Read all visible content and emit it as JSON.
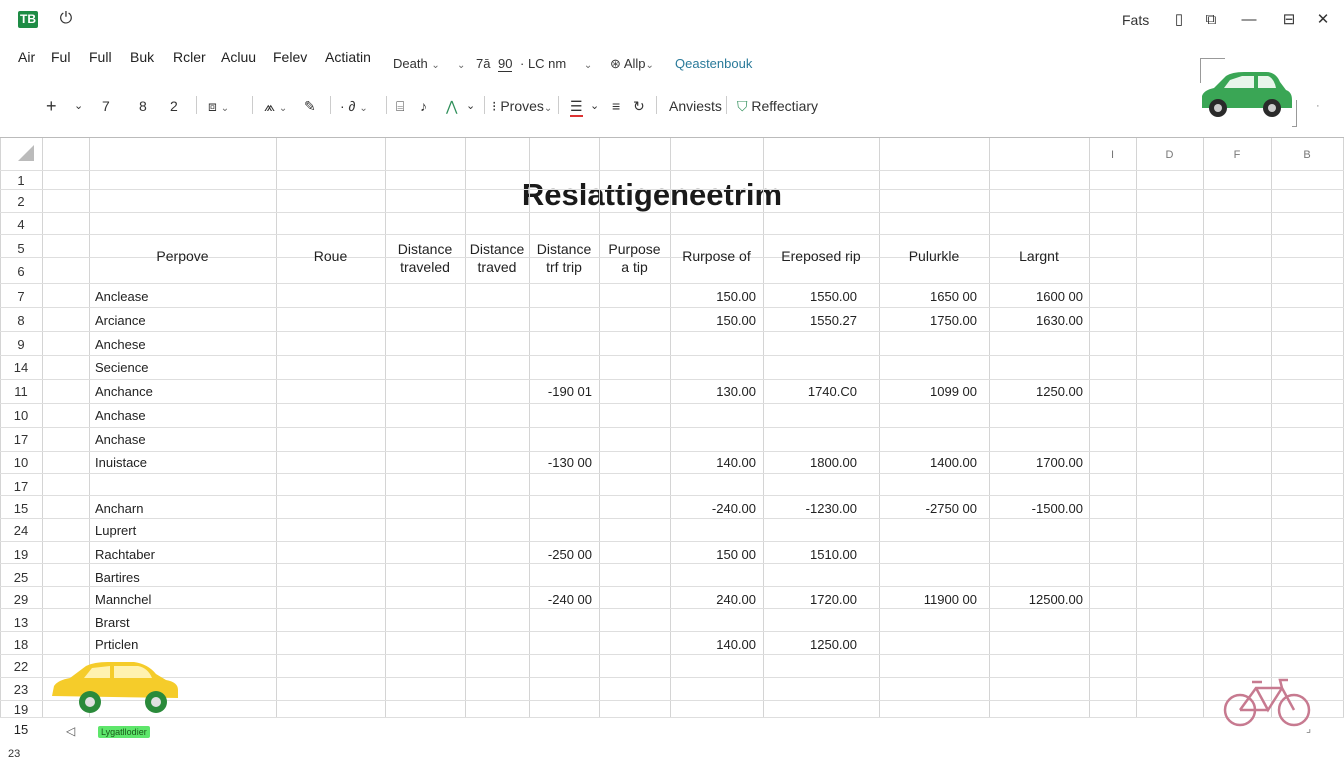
{
  "titlebar": {
    "app_logo": "TB",
    "window_title": "Fats",
    "icons": [
      "power-icon",
      "phone-icon",
      "share-icon",
      "minimize-icon",
      "restore-icon",
      "close-icon"
    ]
  },
  "menu": {
    "items": [
      "Air",
      "Ful",
      "Full",
      "Buk",
      "Rcler",
      "Acluu",
      "Felev",
      "Actiatin"
    ],
    "death": "Death",
    "seven_a": "7ā",
    "ninety": "90",
    "lc_nm": "LC nm",
    "allp": "Allp",
    "search_label": "Qeastenbouk"
  },
  "toolbar": {
    "plus": "+",
    "seven": "7",
    "eight": "8",
    "two": "2",
    "proves": "Proves",
    "anviests": "Anviests",
    "reflectiary": "Reffectiary"
  },
  "sheet": {
    "title": "Reslattigeneetrim",
    "column_letters": [
      "I",
      "D",
      "F",
      "B"
    ],
    "headers": [
      {
        "l1": "Perpove",
        "l2": ""
      },
      {
        "l1": "Roue",
        "l2": ""
      },
      {
        "l1": "Distance",
        "l2": "traveled"
      },
      {
        "l1": "Distance",
        "l2": "traved"
      },
      {
        "l1": "Distance",
        "l2": "trf trip"
      },
      {
        "l1": "Purpose",
        "l2": "a tip"
      },
      {
        "l1": "Rurpose of",
        "l2": ""
      },
      {
        "l1": "Ereposed rip",
        "l2": ""
      },
      {
        "l1": "Pulurkle",
        "l2": ""
      },
      {
        "l1": "Largnt",
        "l2": ""
      }
    ],
    "row_numbers": [
      "1",
      "2",
      "4",
      "5",
      "6",
      "7",
      "8",
      "9",
      "14",
      "11",
      "10",
      "17",
      "10",
      "17",
      "15",
      "24",
      "19",
      "25",
      "29",
      "13",
      "18",
      "22",
      "23",
      "19"
    ],
    "rows": [
      {
        "name": "Anclease",
        "c4": "",
        "c6": "150.00",
        "c7": "1550.00",
        "c8": "1650 00",
        "c9": "1600 00"
      },
      {
        "name": "Arciance",
        "c4": "",
        "c6": "150.00",
        "c7": "1550.27",
        "c8": "1750.00",
        "c9": "1630.00"
      },
      {
        "name": "Anchese",
        "c4": "",
        "c6": "",
        "c7": "",
        "c8": "",
        "c9": ""
      },
      {
        "name": "Secience",
        "c4": "",
        "c6": "",
        "c7": "",
        "c8": "",
        "c9": ""
      },
      {
        "name": "Anchance",
        "c4": "-190 01",
        "c6": "130.00",
        "c7": "1740.C0",
        "c8": "1099 00",
        "c9": "1250.00"
      },
      {
        "name": "Anchase",
        "c4": "",
        "c6": "",
        "c7": "",
        "c8": "",
        "c9": ""
      },
      {
        "name": "Anchase",
        "c4": "",
        "c6": "",
        "c7": "",
        "c8": "",
        "c9": ""
      },
      {
        "name": "Inuistace",
        "c4": "-130 00",
        "c6": "140.00",
        "c7": "1800.00",
        "c8": "1400.00",
        "c9": "1700.00"
      },
      {
        "name": "",
        "c4": "",
        "c6": "",
        "c7": "",
        "c8": "",
        "c9": ""
      },
      {
        "name": "Ancharn",
        "c4": "",
        "c6": "-240.00",
        "c7": "-1230.00",
        "c8": "-2750 00",
        "c9": "-1500.00"
      },
      {
        "name": "Luprert",
        "c4": "",
        "c6": "",
        "c7": "",
        "c8": "",
        "c9": ""
      },
      {
        "name": "Rachtaber",
        "c4": "-250 00",
        "c6": "150 00",
        "c7": "1510.00",
        "c8": "",
        "c9": ""
      },
      {
        "name": "Bartires",
        "c4": "",
        "c6": "",
        "c7": "",
        "c8": "",
        "c9": ""
      },
      {
        "name": "Mannchel",
        "c4": "-240 00",
        "c6": "240.00",
        "c7": "1720.00",
        "c8": "11900 00",
        "c9": "12500.00"
      },
      {
        "name": "Brarst",
        "c4": "",
        "c6": "",
        "c7": "",
        "c8": "",
        "c9": ""
      },
      {
        "name": "Prticlen",
        "c4": "",
        "c6": "140.00",
        "c7": "1250.00",
        "c8": "",
        "c9": ""
      },
      {
        "name": "",
        "c4": "",
        "c6": "",
        "c7": "",
        "c8": "",
        "c9": ""
      },
      {
        "name": "",
        "c4": "",
        "c6": "",
        "c7": "",
        "c8": "",
        "c9": ""
      },
      {
        "name": "",
        "c4": "",
        "c6": "",
        "c7": "",
        "c8": "",
        "c9": ""
      }
    ]
  },
  "footer": {
    "row_number": "15",
    "sheet_tab": "Lygatllodier",
    "status_number": "23"
  },
  "colors": {
    "accent_green": "#1e8c45",
    "car_green": "#3aa655",
    "car_yellow": "#f5cc2a",
    "bike_pink": "#c77a90",
    "sheet_tab_bg": "#5ee66b"
  }
}
